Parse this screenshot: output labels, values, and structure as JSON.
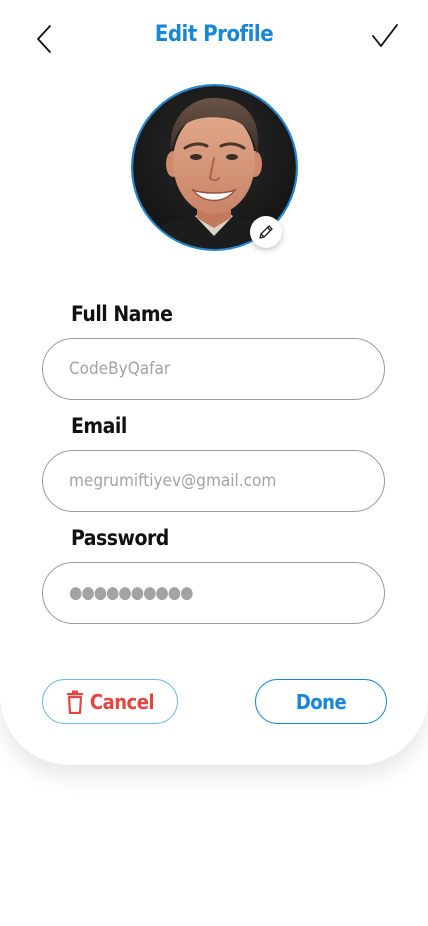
{
  "header": {
    "title": "Edit Profile",
    "back_icon": "chevron-left-icon",
    "confirm_icon": "checkmark-icon"
  },
  "profile": {
    "avatar_icon": "avatar",
    "edit_photo_icon": "pencil-icon"
  },
  "form": {
    "full_name": {
      "label": "Full Name",
      "value": "CodeByQafar"
    },
    "email": {
      "label": "Email",
      "value": "megrumiftiyev@gmail.com"
    },
    "password": {
      "label": "Password",
      "value": "●●●●●●●●●●"
    }
  },
  "actions": {
    "cancel_label": "Cancel",
    "cancel_icon": "trash-icon",
    "done_label": "Done"
  },
  "colors": {
    "accent": "#1a87d6",
    "danger": "#e3473f",
    "placeholder": "#a3a3a3"
  }
}
